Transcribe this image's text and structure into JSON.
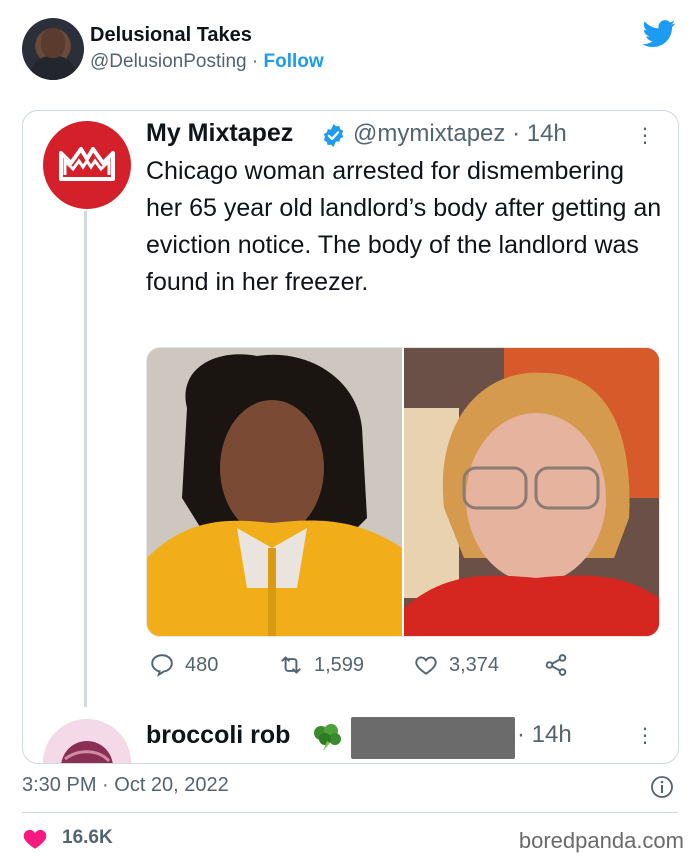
{
  "outer": {
    "name": "Delusional Takes",
    "handle": "@DelusionPosting",
    "separator": "·",
    "follow": "Follow",
    "timestamp": "3:30 PM · Oct 20, 2022",
    "likes": "16.6K",
    "watermark": "boredpanda.com"
  },
  "quoted": {
    "name": "My Mixtapez",
    "handle": "@mymixtapez",
    "age": "· 14h",
    "text": "Chicago woman arrested for dismembering her 65 year old landlord’s body after getting an eviction notice. The body of the landlord was found in her freezer.",
    "logo_text": "MM",
    "actions": {
      "replies": "480",
      "retweets": "1,599",
      "likes": "3,374"
    }
  },
  "reply": {
    "name": "broccoli rob",
    "age": "· 14h",
    "emoji_icon": "broccoli-icon"
  },
  "colors": {
    "accent": "#1d9bf0",
    "heart": "#f91880",
    "logo_red": "#d3202a",
    "muted": "#536471"
  }
}
